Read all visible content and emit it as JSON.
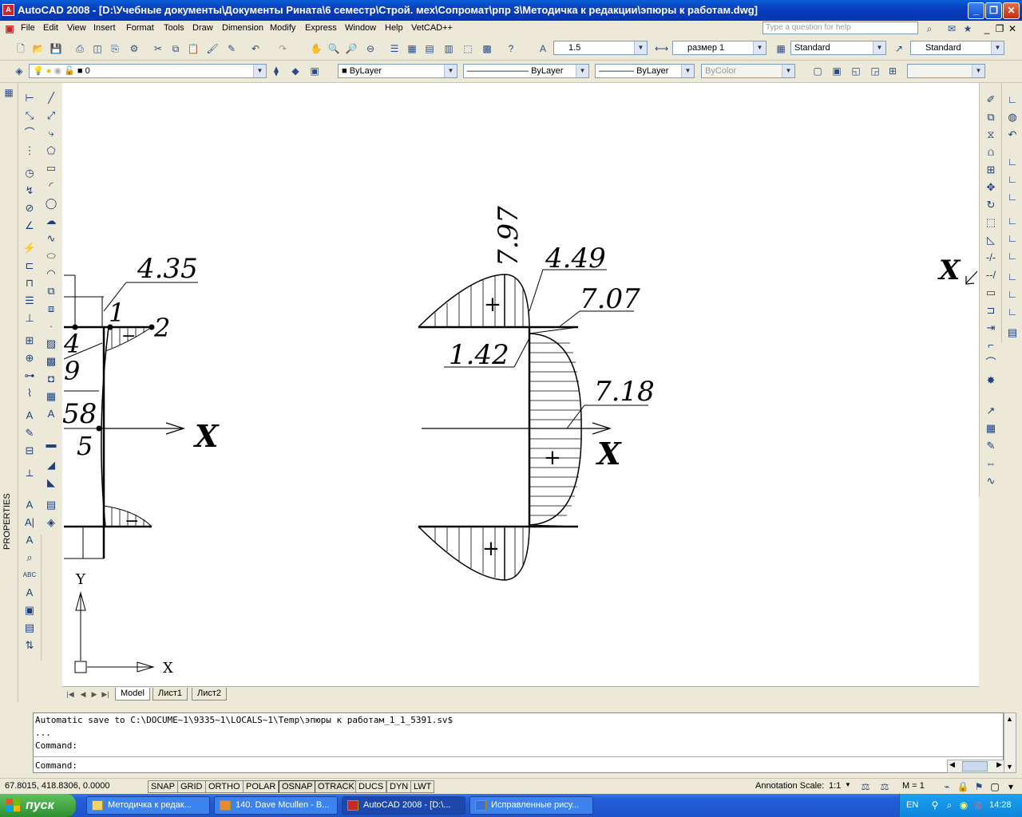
{
  "window": {
    "title": "AutoCAD 2008 - [D:\\Учебные документы\\Документы Рината\\6 семестр\\Строй. мех\\Сопромат\\рпр 3\\Методичка к редакции\\эпюры к работам.dwg]",
    "app_icon": "A",
    "minimize": "_",
    "maximize": "❐",
    "close": "✕"
  },
  "menu": {
    "items": [
      "File",
      "Edit",
      "View",
      "Insert",
      "Format",
      "Tools",
      "Draw",
      "Dimension",
      "Modify",
      "Express",
      "Window",
      "Help",
      "VetCAD++"
    ],
    "help_placeholder": "Type a question for help"
  },
  "toolbar": {
    "text_height": "1.5",
    "dimstyle": "размер 1",
    "textstyle": "Standard",
    "tablestyle": "Standard",
    "layer": "0",
    "color": "ByLayer",
    "linetype": "ByLayer",
    "lineweight": "ByLayer",
    "plotstyle": "ByColor"
  },
  "side": {
    "properties_label": "PROPERTIES"
  },
  "drawing": {
    "left_labels": {
      "v435": "4.35",
      "n1": "1",
      "n2": "2",
      "n4": "4",
      "n9": "9",
      "n58": "58",
      "n5": "5",
      "axis_x": "X",
      "minus_top": "−",
      "minus_bot": "−"
    },
    "right_labels": {
      "v797": "7.97",
      "v449": "4.49",
      "v707": "7.07",
      "v142": "1.42",
      "v718": "7.18",
      "axis_x": "X",
      "plus_top": "+",
      "plus_mid": "+",
      "plus_bot": "+"
    },
    "far_right_x": "X",
    "ucs": {
      "x": "X",
      "y": "Y"
    }
  },
  "layout_tabs": [
    "Model",
    "Лист1",
    "Лист2"
  ],
  "command": {
    "lines": [
      "Automatic save to C:\\DOCUME~1\\9335~1\\LOCALS~1\\Temp\\эпюры к работам_1_1_5391.sv$",
      "...",
      "Command:"
    ],
    "prompt": "Command:"
  },
  "status": {
    "coords": "67.8015, 418.8306, 0.0000",
    "buttons": [
      "SNAP",
      "GRID",
      "ORTHO",
      "POLAR",
      "OSNAP",
      "OTRACK",
      "DUCS",
      "DYN",
      "LWT"
    ],
    "active_buttons": [
      "OSNAP",
      "OTRACK"
    ],
    "annotation_scale_label": "Annotation Scale:",
    "annotation_scale": "1:1",
    "m_value": "M = 1"
  },
  "taskbar": {
    "start": "пуск",
    "tasks": [
      "Методичка к редак...",
      "140. Dave Mcullen - B...",
      "AutoCAD 2008 - [D:\\...",
      "Исправленные рису..."
    ],
    "active_task": 2,
    "lang": "EN",
    "time": "14:28"
  }
}
